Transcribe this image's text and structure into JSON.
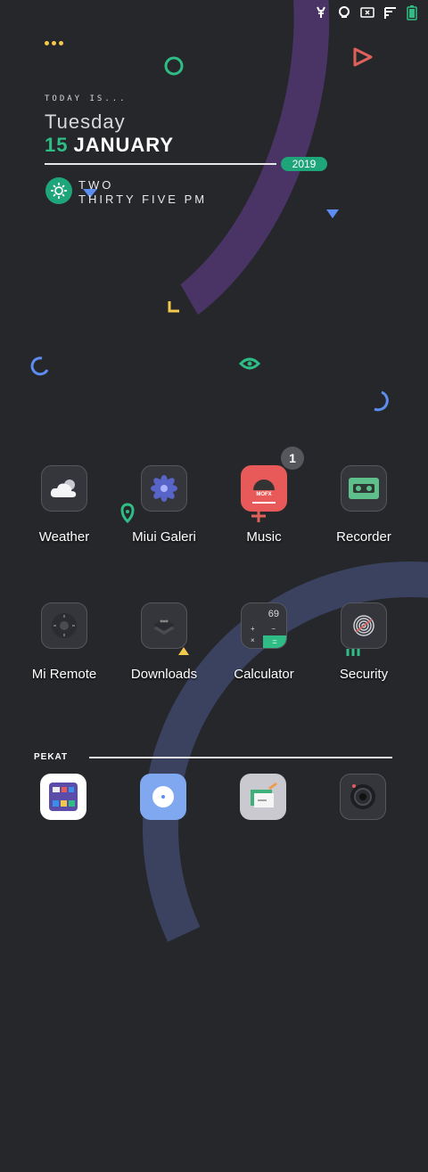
{
  "status_bar": {
    "icons": [
      "deer-icon",
      "sync-icon",
      "mute-icon",
      "signal-icon",
      "battery-icon"
    ]
  },
  "clock_widget": {
    "today_label": "TODAY IS...",
    "weekday": "Tuesday",
    "day": "15",
    "month": "JANUARY",
    "year": "2019",
    "time_line1": "TWO",
    "time_line2": "THIRTY FIVE PM"
  },
  "apps": [
    {
      "label": "Weather",
      "icon": "weather-icon"
    },
    {
      "label": "Miui Galeri",
      "icon": "gallery-icon"
    },
    {
      "label": "Music",
      "icon": "music-icon",
      "badge": "1"
    },
    {
      "label": "Recorder",
      "icon": "recorder-icon"
    },
    {
      "label": "Mi Remote",
      "icon": "remote-icon"
    },
    {
      "label": "Downloads",
      "icon": "downloads-icon"
    },
    {
      "label": "Calculator",
      "icon": "calculator-icon"
    },
    {
      "label": "Security",
      "icon": "security-icon"
    }
  ],
  "music_icon_text": "MOFX",
  "calculator_icon_text": {
    "display": "69",
    "ops": [
      "+",
      "−",
      "×",
      "="
    ]
  },
  "dock": {
    "label": "PEKAT",
    "apps": [
      "file-manager-icon",
      "browser-icon",
      "notes-icon",
      "camera-icon"
    ]
  },
  "colors": {
    "background": "#26272b",
    "accent_green": "#2ebd85",
    "accent_purple": "#4a3466",
    "accent_blue": "#3a4260"
  }
}
